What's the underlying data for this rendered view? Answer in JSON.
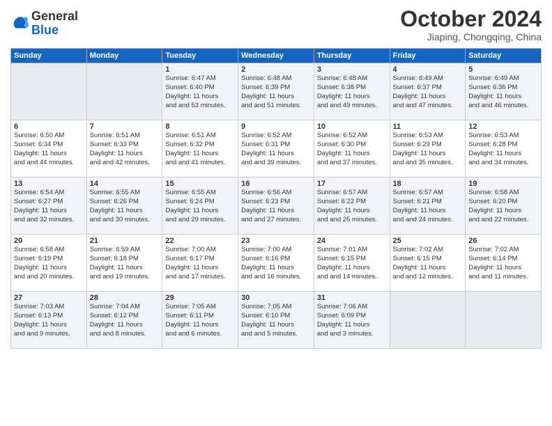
{
  "logo": {
    "line1": "General",
    "line2": "Blue"
  },
  "title": "October 2024",
  "subtitle": "Jiaping, Chongqing, China",
  "days_of_week": [
    "Sunday",
    "Monday",
    "Tuesday",
    "Wednesday",
    "Thursday",
    "Friday",
    "Saturday"
  ],
  "weeks": [
    [
      {
        "day": "",
        "empty": true
      },
      {
        "day": "",
        "empty": true
      },
      {
        "day": "1",
        "sunrise": "Sunrise: 6:47 AM",
        "sunset": "Sunset: 6:40 PM",
        "daylight": "Daylight: 11 hours and 53 minutes."
      },
      {
        "day": "2",
        "sunrise": "Sunrise: 6:48 AM",
        "sunset": "Sunset: 6:39 PM",
        "daylight": "Daylight: 11 hours and 51 minutes."
      },
      {
        "day": "3",
        "sunrise": "Sunrise: 6:48 AM",
        "sunset": "Sunset: 6:38 PM",
        "daylight": "Daylight: 11 hours and 49 minutes."
      },
      {
        "day": "4",
        "sunrise": "Sunrise: 6:49 AM",
        "sunset": "Sunset: 6:37 PM",
        "daylight": "Daylight: 11 hours and 47 minutes."
      },
      {
        "day": "5",
        "sunrise": "Sunrise: 6:49 AM",
        "sunset": "Sunset: 6:36 PM",
        "daylight": "Daylight: 11 hours and 46 minutes."
      }
    ],
    [
      {
        "day": "6",
        "sunrise": "Sunrise: 6:50 AM",
        "sunset": "Sunset: 6:34 PM",
        "daylight": "Daylight: 11 hours and 44 minutes."
      },
      {
        "day": "7",
        "sunrise": "Sunrise: 6:51 AM",
        "sunset": "Sunset: 6:33 PM",
        "daylight": "Daylight: 11 hours and 42 minutes."
      },
      {
        "day": "8",
        "sunrise": "Sunrise: 6:51 AM",
        "sunset": "Sunset: 6:32 PM",
        "daylight": "Daylight: 11 hours and 41 minutes."
      },
      {
        "day": "9",
        "sunrise": "Sunrise: 6:52 AM",
        "sunset": "Sunset: 6:31 PM",
        "daylight": "Daylight: 11 hours and 39 minutes."
      },
      {
        "day": "10",
        "sunrise": "Sunrise: 6:52 AM",
        "sunset": "Sunset: 6:30 PM",
        "daylight": "Daylight: 11 hours and 37 minutes."
      },
      {
        "day": "11",
        "sunrise": "Sunrise: 6:53 AM",
        "sunset": "Sunset: 6:29 PM",
        "daylight": "Daylight: 11 hours and 35 minutes."
      },
      {
        "day": "12",
        "sunrise": "Sunrise: 6:53 AM",
        "sunset": "Sunset: 6:28 PM",
        "daylight": "Daylight: 11 hours and 34 minutes."
      }
    ],
    [
      {
        "day": "13",
        "sunrise": "Sunrise: 6:54 AM",
        "sunset": "Sunset: 6:27 PM",
        "daylight": "Daylight: 11 hours and 32 minutes."
      },
      {
        "day": "14",
        "sunrise": "Sunrise: 6:55 AM",
        "sunset": "Sunset: 6:26 PM",
        "daylight": "Daylight: 11 hours and 30 minutes."
      },
      {
        "day": "15",
        "sunrise": "Sunrise: 6:55 AM",
        "sunset": "Sunset: 6:24 PM",
        "daylight": "Daylight: 11 hours and 29 minutes."
      },
      {
        "day": "16",
        "sunrise": "Sunrise: 6:56 AM",
        "sunset": "Sunset: 6:23 PM",
        "daylight": "Daylight: 11 hours and 27 minutes."
      },
      {
        "day": "17",
        "sunrise": "Sunrise: 6:57 AM",
        "sunset": "Sunset: 6:22 PM",
        "daylight": "Daylight: 11 hours and 25 minutes."
      },
      {
        "day": "18",
        "sunrise": "Sunrise: 6:57 AM",
        "sunset": "Sunset: 6:21 PM",
        "daylight": "Daylight: 11 hours and 24 minutes."
      },
      {
        "day": "19",
        "sunrise": "Sunrise: 6:58 AM",
        "sunset": "Sunset: 6:20 PM",
        "daylight": "Daylight: 11 hours and 22 minutes."
      }
    ],
    [
      {
        "day": "20",
        "sunrise": "Sunrise: 6:58 AM",
        "sunset": "Sunset: 6:19 PM",
        "daylight": "Daylight: 11 hours and 20 minutes."
      },
      {
        "day": "21",
        "sunrise": "Sunrise: 6:59 AM",
        "sunset": "Sunset: 6:18 PM",
        "daylight": "Daylight: 11 hours and 19 minutes."
      },
      {
        "day": "22",
        "sunrise": "Sunrise: 7:00 AM",
        "sunset": "Sunset: 6:17 PM",
        "daylight": "Daylight: 11 hours and 17 minutes."
      },
      {
        "day": "23",
        "sunrise": "Sunrise: 7:00 AM",
        "sunset": "Sunset: 6:16 PM",
        "daylight": "Daylight: 11 hours and 16 minutes."
      },
      {
        "day": "24",
        "sunrise": "Sunrise: 7:01 AM",
        "sunset": "Sunset: 6:15 PM",
        "daylight": "Daylight: 11 hours and 14 minutes."
      },
      {
        "day": "25",
        "sunrise": "Sunrise: 7:02 AM",
        "sunset": "Sunset: 6:15 PM",
        "daylight": "Daylight: 11 hours and 12 minutes."
      },
      {
        "day": "26",
        "sunrise": "Sunrise: 7:02 AM",
        "sunset": "Sunset: 6:14 PM",
        "daylight": "Daylight: 11 hours and 11 minutes."
      }
    ],
    [
      {
        "day": "27",
        "sunrise": "Sunrise: 7:03 AM",
        "sunset": "Sunset: 6:13 PM",
        "daylight": "Daylight: 11 hours and 9 minutes."
      },
      {
        "day": "28",
        "sunrise": "Sunrise: 7:04 AM",
        "sunset": "Sunset: 6:12 PM",
        "daylight": "Daylight: 11 hours and 8 minutes."
      },
      {
        "day": "29",
        "sunrise": "Sunrise: 7:05 AM",
        "sunset": "Sunset: 6:11 PM",
        "daylight": "Daylight: 11 hours and 6 minutes."
      },
      {
        "day": "30",
        "sunrise": "Sunrise: 7:05 AM",
        "sunset": "Sunset: 6:10 PM",
        "daylight": "Daylight: 11 hours and 5 minutes."
      },
      {
        "day": "31",
        "sunrise": "Sunrise: 7:06 AM",
        "sunset": "Sunset: 6:09 PM",
        "daylight": "Daylight: 11 hours and 3 minutes."
      },
      {
        "day": "",
        "empty": true
      },
      {
        "day": "",
        "empty": true
      }
    ]
  ]
}
